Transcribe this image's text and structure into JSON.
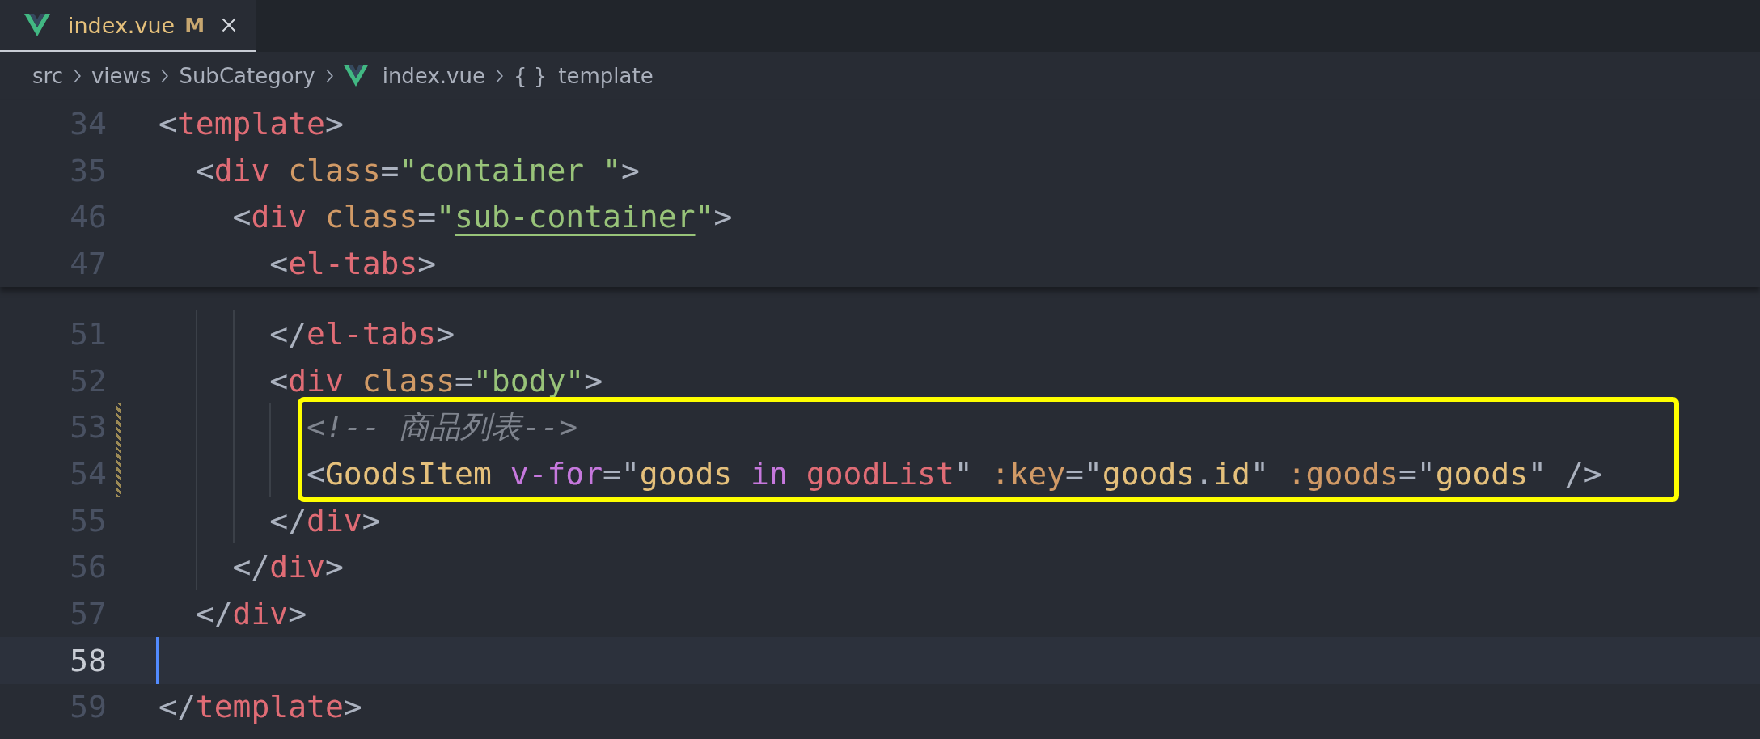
{
  "tabs": [
    {
      "label": "index.vue",
      "badge": "M",
      "selected": true
    }
  ],
  "breadcrumb": [
    {
      "kind": "folder",
      "text": "src"
    },
    {
      "kind": "folder",
      "text": "views"
    },
    {
      "kind": "folder",
      "text": "SubCategory"
    },
    {
      "kind": "vue",
      "text": "index.vue"
    },
    {
      "kind": "symbol",
      "icon_text": "{ }",
      "text": "template"
    }
  ],
  "sticky_lines": [
    {
      "number": "34",
      "tokens": [
        {
          "kind": "punct",
          "text": "<"
        },
        {
          "kind": "tag",
          "text": "template"
        },
        {
          "kind": "punct",
          "text": ">"
        }
      ]
    },
    {
      "number": "35",
      "tokens": [
        {
          "kind": "punct",
          "text": "  <"
        },
        {
          "kind": "tag",
          "text": "div"
        },
        {
          "kind": "attr",
          "text": " class"
        },
        {
          "kind": "punct",
          "text": "="
        },
        {
          "kind": "string",
          "text": "\"container \""
        },
        {
          "kind": "punct",
          "text": ">"
        }
      ]
    },
    {
      "number": "46",
      "tokens": [
        {
          "kind": "punct",
          "text": "    <"
        },
        {
          "kind": "tag",
          "text": "div"
        },
        {
          "kind": "attr",
          "text": " class"
        },
        {
          "kind": "punct",
          "text": "="
        },
        {
          "kind": "string",
          "text": "\""
        },
        {
          "kind": "string-underlined",
          "text": "sub-container"
        },
        {
          "kind": "string",
          "text": "\""
        },
        {
          "kind": "punct",
          "text": ">"
        }
      ]
    },
    {
      "number": "47",
      "tokens": [
        {
          "kind": "punct",
          "text": "      <"
        },
        {
          "kind": "tag",
          "text": "el-tabs"
        },
        {
          "kind": "punct",
          "text": ">"
        }
      ]
    }
  ],
  "lines": [
    {
      "number": "51",
      "modified": false,
      "current": false,
      "highlight": false,
      "tokens": [
        {
          "kind": "punct",
          "text": "      </"
        },
        {
          "kind": "tag",
          "text": "el-tabs"
        },
        {
          "kind": "punct",
          "text": ">"
        }
      ]
    },
    {
      "number": "52",
      "modified": false,
      "current": false,
      "highlight": false,
      "tokens": [
        {
          "kind": "punct",
          "text": "      <"
        },
        {
          "kind": "tag",
          "text": "div"
        },
        {
          "kind": "attr",
          "text": " class"
        },
        {
          "kind": "punct",
          "text": "="
        },
        {
          "kind": "string",
          "text": "\"body\""
        },
        {
          "kind": "punct",
          "text": ">"
        }
      ]
    },
    {
      "number": "53",
      "modified": true,
      "current": false,
      "highlight": true,
      "tokens": [
        {
          "kind": "comment",
          "text": "        <!-- 商品列表-->"
        }
      ]
    },
    {
      "number": "54",
      "modified": true,
      "current": false,
      "highlight": true,
      "tokens": [
        {
          "kind": "punct",
          "text": "        <"
        },
        {
          "kind": "component",
          "text": "GoodsItem"
        },
        {
          "kind": "directive",
          "text": " v-for"
        },
        {
          "kind": "punct",
          "text": "=\""
        },
        {
          "kind": "component",
          "text": "goods"
        },
        {
          "kind": "directive",
          "text": " in "
        },
        {
          "kind": "tag",
          "text": "goodList"
        },
        {
          "kind": "punct",
          "text": "\""
        },
        {
          "kind": "attr",
          "text": " :key"
        },
        {
          "kind": "punct",
          "text": "=\""
        },
        {
          "kind": "component",
          "text": "goods"
        },
        {
          "kind": "punct",
          "text": "."
        },
        {
          "kind": "component",
          "text": "id"
        },
        {
          "kind": "punct",
          "text": "\""
        },
        {
          "kind": "attr",
          "text": " :goods"
        },
        {
          "kind": "punct",
          "text": "=\""
        },
        {
          "kind": "component",
          "text": "goods"
        },
        {
          "kind": "punct",
          "text": "\" />"
        }
      ]
    },
    {
      "number": "55",
      "modified": false,
      "current": false,
      "highlight": false,
      "tokens": [
        {
          "kind": "punct",
          "text": "      </"
        },
        {
          "kind": "tag",
          "text": "div"
        },
        {
          "kind": "punct",
          "text": ">"
        }
      ]
    },
    {
      "number": "56",
      "modified": false,
      "current": false,
      "highlight": false,
      "tokens": [
        {
          "kind": "punct",
          "text": "    </"
        },
        {
          "kind": "tag",
          "text": "div"
        },
        {
          "kind": "punct",
          "text": ">"
        }
      ]
    },
    {
      "number": "57",
      "modified": false,
      "current": false,
      "highlight": false,
      "tokens": [
        {
          "kind": "punct",
          "text": "  </"
        },
        {
          "kind": "tag",
          "text": "div"
        },
        {
          "kind": "punct",
          "text": ">"
        }
      ]
    },
    {
      "number": "58",
      "modified": false,
      "current": true,
      "highlight": false
    },
    {
      "number": "59",
      "modified": false,
      "current": false,
      "highlight": false,
      "tokens": [
        {
          "kind": "punct",
          "text": "</"
        },
        {
          "kind": "tag",
          "text": "template"
        },
        {
          "kind": "punct",
          "text": ">"
        }
      ]
    }
  ]
}
